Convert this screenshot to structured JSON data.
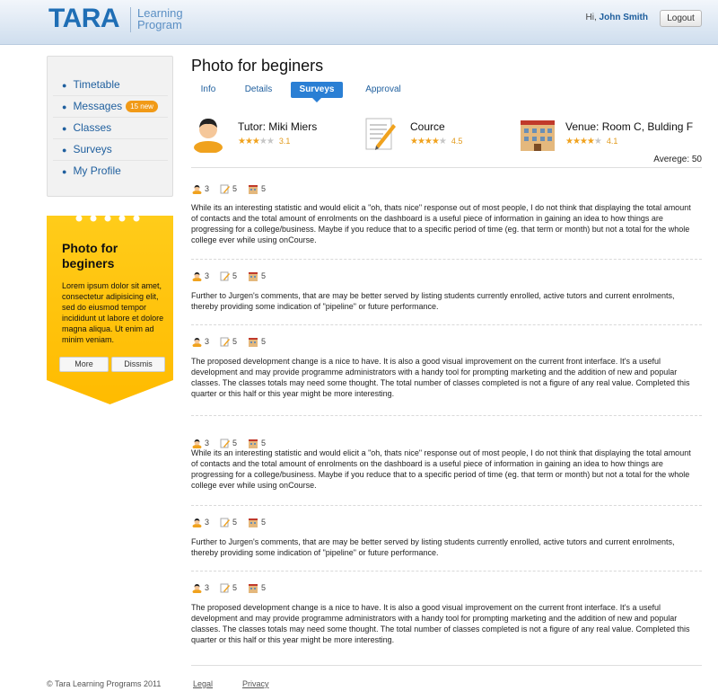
{
  "header": {
    "logo": "TARA",
    "logo_sub_1": "Learning",
    "logo_sub_2": "Program",
    "greeting": "Hi,",
    "user": "John Smith",
    "logout": "Logout"
  },
  "sidebar": {
    "items": [
      {
        "label": "Timetable"
      },
      {
        "label": "Messages",
        "badge": "15 new"
      },
      {
        "label": "Classes"
      },
      {
        "label": "Surveys"
      },
      {
        "label": "My Profile"
      }
    ]
  },
  "promo": {
    "title": "Photo for beginers",
    "text": "Lorem ipsum dolor sit amet, consectetur adipisicing elit, sed do eiusmod tempor incididunt ut labore et dolore magna aliqua. Ut enim ad minim veniam.",
    "more": "More",
    "dismiss": "Dissmis"
  },
  "page": {
    "title": "Photo for beginers"
  },
  "tabs": [
    {
      "label": "Info"
    },
    {
      "label": "Details"
    },
    {
      "label": "Surveys",
      "active": true
    },
    {
      "label": "Approval"
    }
  ],
  "stats": [
    {
      "label": "Tutor: Miki Miers",
      "rating": "3.1",
      "stars": 3
    },
    {
      "label": "Cource",
      "rating": "4.5",
      "stars": 4
    },
    {
      "label": "Venue: Room C, Bulding F",
      "rating": "4.1",
      "stars": 4
    }
  ],
  "average": "Averege: 50",
  "comments": [
    {
      "tutor": "3",
      "course": "5",
      "venue": "5",
      "text": "While its an interesting statistic and would elicit a \"oh, thats nice\" response out of most people, I do not think that displaying the total amount of contacts and the total amount of enrolments on the dashboard is a useful piece of information in gaining an idea to how things are progressing for a college/business. Maybe if you reduce that to a specific period of time (eg. that term or month) but not a total for the whole college ever while using onCourse."
    },
    {
      "tutor": "3",
      "course": "5",
      "venue": "5",
      "text": "Further to Jurgen's comments, that are may be better served by listing students currently enrolled, active tutors and current enrolments, thereby providing some indication of \"pipeline\" or future performance."
    },
    {
      "tutor": "3",
      "course": "5",
      "venue": "5",
      "text": "The proposed development change is a nice to have. It is also a good visual improvement on the current front interface. It's a useful development and may provide programme administrators with a handy tool for prompting marketing and the addition of new and popular classes. The classes totals may need some thought. The total number of classes completed is not a figure of any real value. Completed this quarter or this half or this year might be more interesting."
    },
    {
      "tutor": "3",
      "course": "5",
      "venue": "5",
      "text": "While its an interesting statistic and would elicit a \"oh, thats nice\" response out of most people, I do not think that displaying the total amount of contacts and the total amount of enrolments on the dashboard is a useful piece of information in gaining an idea to how things are progressing for a college/business. Maybe if you reduce that to a specific period of time (eg. that term or month) but not a total for the whole college ever while using onCourse."
    },
    {
      "tutor": "3",
      "course": "5",
      "venue": "5",
      "text": "Further to Jurgen's comments, that are may be better served by listing students currently enrolled, active tutors and current enrolments, thereby providing some indication of \"pipeline\" or future performance."
    },
    {
      "tutor": "3",
      "course": "5",
      "venue": "5",
      "text": "The proposed development change is a nice to have. It is also a good visual improvement on the current front interface. It's a useful development and may provide programme administrators with a handy tool for prompting marketing and the addition of new and popular classes. The classes totals may need some thought. The total number of classes completed is not a figure of any real value. Completed this quarter or this half or this year might be more interesting."
    }
  ],
  "footer": {
    "copyright": "© Tara Learning Programs 2011",
    "legal": "Legal",
    "privacy": "Privacy"
  },
  "colors": {
    "accent": "#2a7fd4",
    "brand": "#1f6eb5",
    "promo": "#ffc20e",
    "star": "#f0a21e"
  },
  "icons": {
    "tutor": "person-icon",
    "course": "document-pencil-icon",
    "venue": "building-icon"
  }
}
